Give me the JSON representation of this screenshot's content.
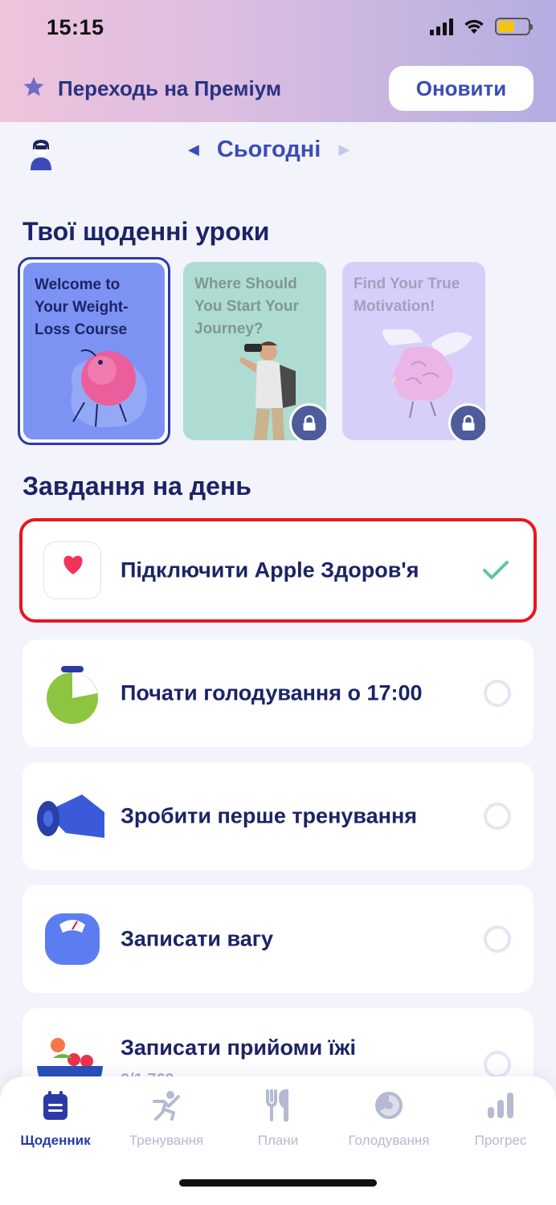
{
  "status_bar": {
    "time": "15:15",
    "battery_level": 0.55
  },
  "premium_banner": {
    "text": "Переходь на Преміум",
    "button_label": "Оновити"
  },
  "header": {
    "date_label": "Сьогодні"
  },
  "lessons": {
    "title": "Твої щоденні уроки",
    "items": [
      {
        "title": "Welcome to Your Weight-Loss Course",
        "locked": false
      },
      {
        "title": "Where Should You Start Your Journey?",
        "locked": true
      },
      {
        "title": "Find Your True Motivation!",
        "locked": true
      }
    ]
  },
  "tasks": {
    "title": "Завдання на день",
    "items": [
      {
        "label": "Підключити Apple Здоров'я",
        "done": true
      },
      {
        "label": "Почати голодування о 17:00",
        "done": false
      },
      {
        "label": "Зробити перше тренування",
        "done": false
      },
      {
        "label": "Записати вагу",
        "done": false
      },
      {
        "label": "Записати прийоми їжі",
        "sub": "0/1 769",
        "done": false
      }
    ]
  },
  "tab_bar": {
    "active": "Щоденник",
    "items": [
      {
        "label": "Щоденник",
        "icon": "calendar-icon"
      },
      {
        "label": "Тренування",
        "icon": "workout-icon"
      },
      {
        "label": "Плани",
        "icon": "fork-knife-icon"
      },
      {
        "label": "Голодування",
        "icon": "fasting-icon"
      },
      {
        "label": "Прогрес",
        "icon": "bar-chart-icon"
      }
    ]
  },
  "colors": {
    "accent": "#3b4cb8",
    "highlight": "#e8161f",
    "premium_gradient": [
      "#efc3dc",
      "#b4ade1"
    ]
  }
}
